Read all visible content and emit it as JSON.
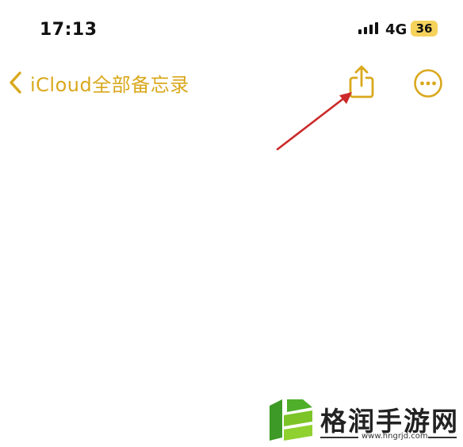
{
  "status_bar": {
    "time": "17:13",
    "network": "4G",
    "battery": "36",
    "battery_color": "#f5d25b",
    "signal_icon": "signal-bars-icon"
  },
  "nav_bar": {
    "back_label": "iCloud全部备忘录",
    "back_icon": "chevron-left-icon",
    "share_icon": "share-icon",
    "more_icon": "more-ellipsis-icon",
    "accent_color": "#d9a81c"
  },
  "note": {
    "content": ""
  },
  "annotation": {
    "arrow_color": "#cc2a2a"
  },
  "watermark": {
    "name": "格润手游网",
    "url": "www.hngrjd.com"
  }
}
